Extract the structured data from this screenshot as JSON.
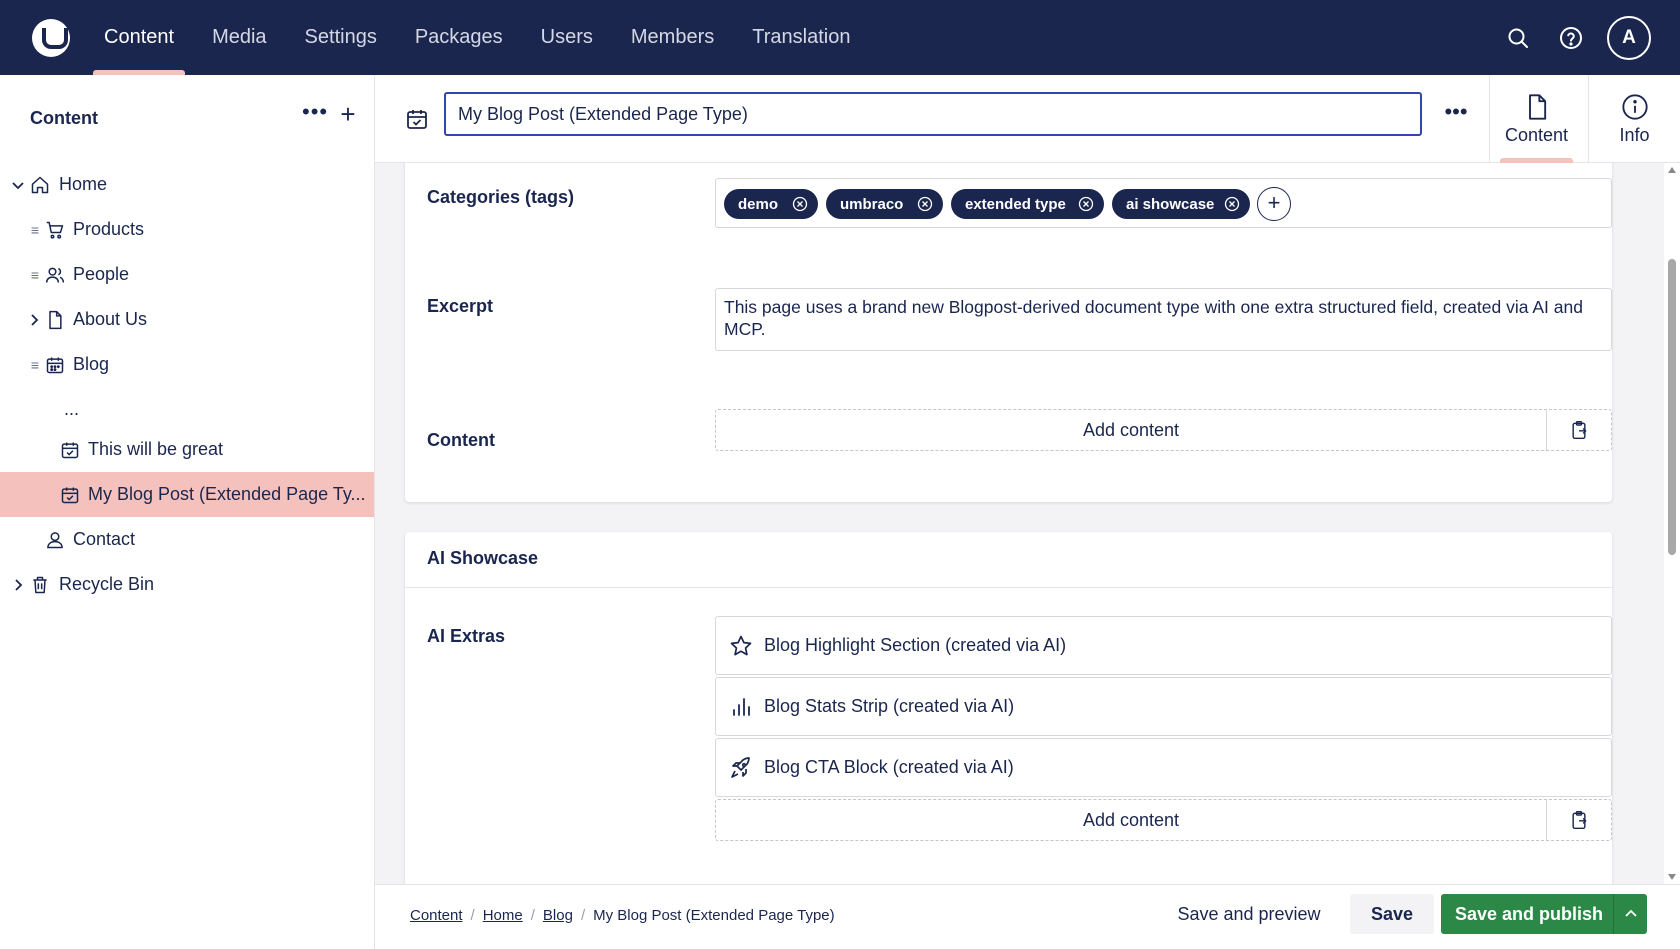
{
  "header": {
    "nav": [
      "Content",
      "Media",
      "Settings",
      "Packages",
      "Users",
      "Members",
      "Translation"
    ],
    "active_nav": "Content",
    "avatar_initial": "A"
  },
  "sidebar": {
    "title": "Content",
    "tree": [
      {
        "label": "Home",
        "icon": "home-icon",
        "expanded": true
      },
      {
        "label": "Products",
        "icon": "cart-icon"
      },
      {
        "label": "People",
        "icon": "users-icon"
      },
      {
        "label": "About Us",
        "icon": "document-icon"
      },
      {
        "label": "Blog",
        "icon": "calendar-icon"
      },
      {
        "label": "..."
      },
      {
        "label": "This will be great",
        "icon": "calendar-check-icon"
      },
      {
        "label": "My Blog Post (Extended Page Ty...",
        "icon": "calendar-check-icon",
        "selected": true
      },
      {
        "label": "Contact",
        "icon": "user-icon"
      },
      {
        "label": "Recycle Bin",
        "icon": "trash-icon"
      }
    ]
  },
  "editor": {
    "name_value": "My Blog Post (Extended Page Type)",
    "views": [
      {
        "label": "Content",
        "icon": "document-icon",
        "active": true
      },
      {
        "label": "Info",
        "icon": "info-icon"
      }
    ],
    "properties": {
      "tags_label": "Categories (tags)",
      "tags": [
        "demo",
        "umbraco",
        "extended type",
        "ai showcase"
      ],
      "excerpt_label": "Excerpt",
      "excerpt_value": "This page uses a brand new Blogpost-derived document type with one extra structured field, created via AI and MCP.",
      "content_label": "Content",
      "add_content_label": "Add content"
    },
    "ai_showcase": {
      "title": "AI Showcase",
      "extras_label": "AI Extras",
      "blocks": [
        {
          "label": "Blog Highlight Section (created via AI)",
          "icon": "star-icon"
        },
        {
          "label": "Blog Stats Strip (created via AI)",
          "icon": "bar-chart-icon"
        },
        {
          "label": "Blog CTA Block (created via AI)",
          "icon": "rocket-icon"
        }
      ],
      "add_content_label": "Add content"
    }
  },
  "footer": {
    "breadcrumb": [
      "Content",
      "Home",
      "Blog",
      "My Blog Post (Extended Page Type)"
    ],
    "save_preview_label": "Save and preview",
    "save_label": "Save",
    "publish_label": "Save and publish"
  },
  "colors": {
    "header_bg": "#1b264f",
    "accent_pink": "#f5c1bc",
    "publish_green": "#2b8846",
    "tag_bg": "#1b264f"
  }
}
